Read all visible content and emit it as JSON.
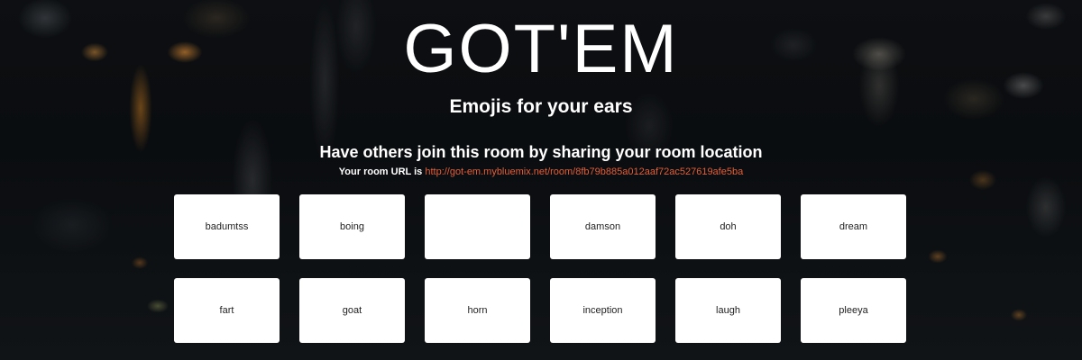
{
  "header": {
    "logo_text": "GOT'EM",
    "tagline": "Emojis for your ears"
  },
  "share": {
    "heading": "Have others join this room by sharing your room location",
    "url_prefix": "Your room URL is",
    "url": "http://got-em.mybluemix.net/room/8fb79b885a012aaf72ac527619afe5ba"
  },
  "sounds": [
    {
      "label": "badumtss"
    },
    {
      "label": "boing"
    },
    {
      "label": ""
    },
    {
      "label": "damson"
    },
    {
      "label": "doh"
    },
    {
      "label": "dream"
    },
    {
      "label": "fart"
    },
    {
      "label": "goat"
    },
    {
      "label": "horn"
    },
    {
      "label": "inception"
    },
    {
      "label": "laugh"
    },
    {
      "label": "pleeya"
    }
  ],
  "colors": {
    "link": "#e0603a",
    "button_bg": "#ffffff",
    "button_text": "#222222"
  }
}
